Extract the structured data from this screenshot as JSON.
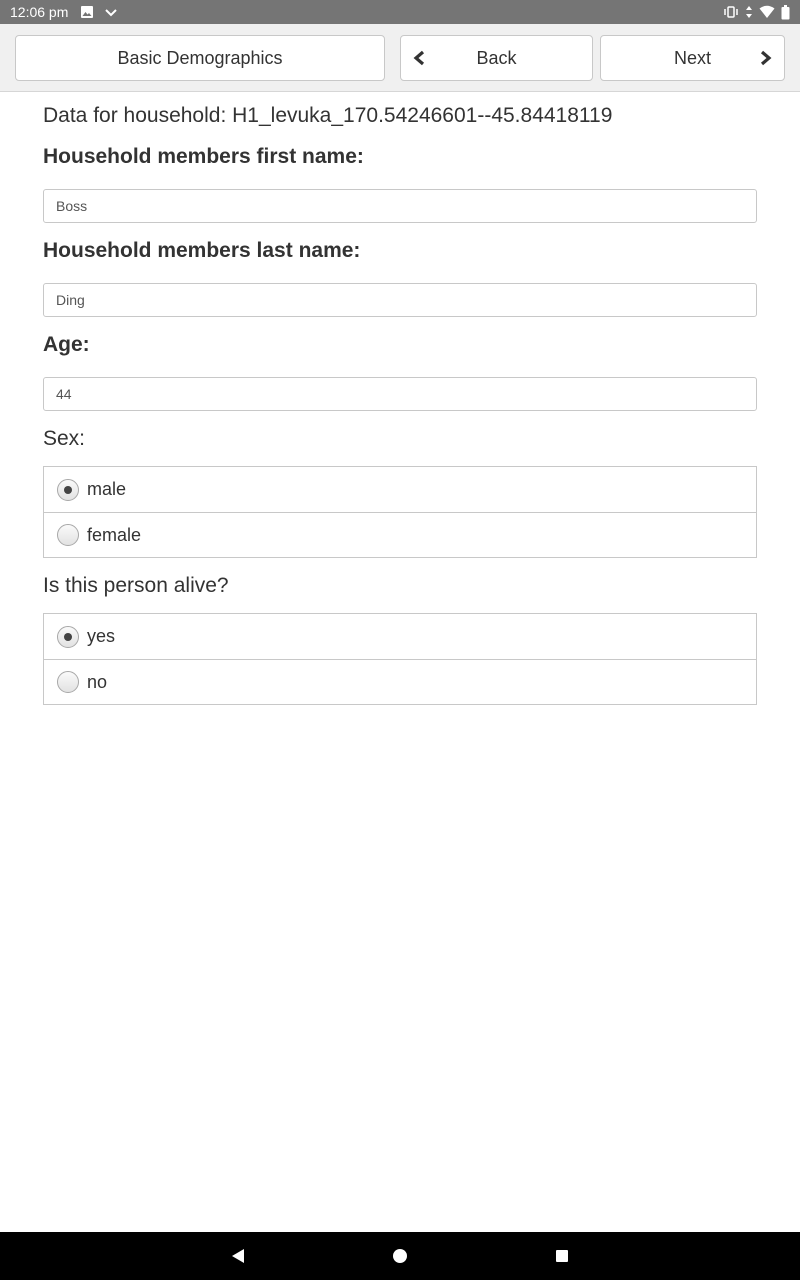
{
  "status_bar": {
    "time": "12:06 pm",
    "left_icons": [
      "image-notification-icon",
      "checkmark-notification-icon"
    ],
    "right_icons": [
      "vibrate-icon",
      "data-arrows-icon",
      "wifi-icon",
      "battery-icon"
    ]
  },
  "toolbar": {
    "section_label": "Basic Demographics",
    "back_label": "Back",
    "next_label": "Next",
    "back_icon": "chevron-left-icon",
    "next_icon": "chevron-right-icon"
  },
  "form": {
    "household_line": "Data for household: H1_levuka_170.54246601--45.84418119",
    "first_name": {
      "label": "Household members first name:",
      "value": "Boss"
    },
    "last_name": {
      "label": "Household members last name:",
      "value": "Ding"
    },
    "age": {
      "label": "Age:",
      "value": "44"
    },
    "sex": {
      "label": "Sex:",
      "options": [
        {
          "label": "male",
          "selected": true
        },
        {
          "label": "female",
          "selected": false
        }
      ]
    },
    "alive": {
      "label": "Is this person alive?",
      "options": [
        {
          "label": "yes",
          "selected": true
        },
        {
          "label": "no",
          "selected": false
        }
      ]
    }
  },
  "nav_bar": {
    "icons": [
      "back-triangle-icon",
      "home-circle-icon",
      "recents-square-icon"
    ]
  },
  "colors": {
    "status_bar": "#757575",
    "toolbar_bg": "#f0f0f0",
    "border": "#c8c8c8",
    "text": "#333333",
    "nav_bar": "#000000"
  }
}
